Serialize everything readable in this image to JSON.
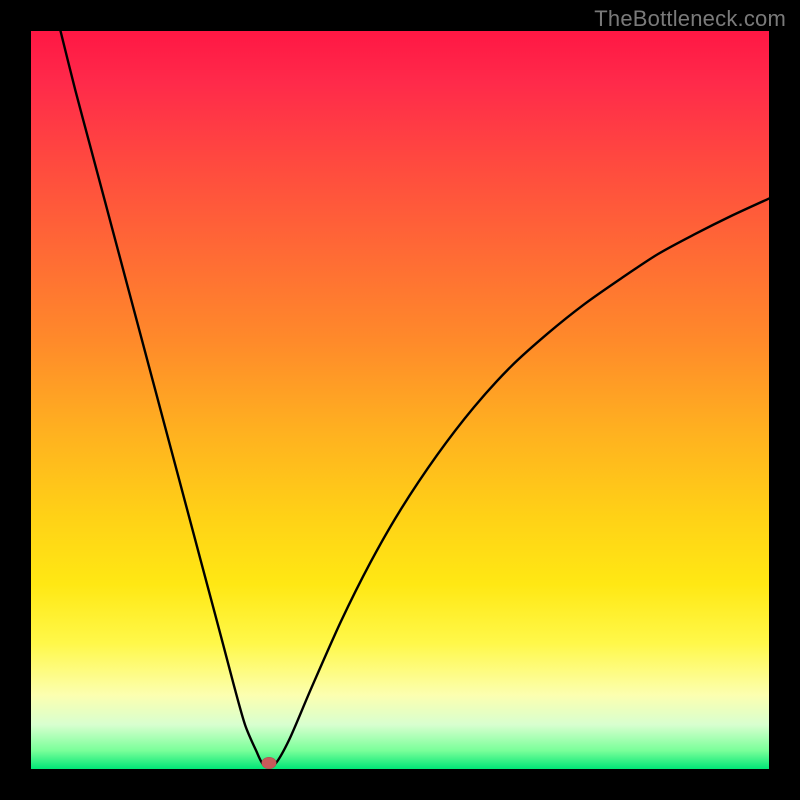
{
  "attribution": "TheBottleneck.com",
  "colors": {
    "frame": "#000000",
    "curve": "#000000",
    "dot": "#c75a5a"
  },
  "chart_data": {
    "type": "line",
    "title": "",
    "xlabel": "",
    "ylabel": "",
    "xlim": [
      0,
      100
    ],
    "ylim": [
      0,
      100
    ],
    "grid": false,
    "legend": false,
    "series": [
      {
        "name": "bottleneck-curve",
        "x": [
          4,
          6,
          8,
          10,
          12,
          14,
          16,
          18,
          20,
          22,
          24,
          26,
          27.5,
          29,
          30.5,
          31.5,
          33,
          35,
          38,
          42,
          46,
          50,
          55,
          60,
          65,
          70,
          75,
          80,
          85,
          90,
          95,
          100
        ],
        "y": [
          100,
          92,
          84.5,
          77,
          69.5,
          62,
          54.5,
          47,
          39.5,
          32,
          24.5,
          17,
          11.3,
          6,
          2.5,
          0.6,
          0.6,
          4,
          11,
          20,
          28,
          35,
          42.5,
          49,
          54.5,
          59,
          63,
          66.5,
          69.8,
          72.5,
          75,
          77.3
        ]
      }
    ],
    "marker": {
      "name": "optimal-point",
      "x": 32.3,
      "y": 0.8
    }
  }
}
